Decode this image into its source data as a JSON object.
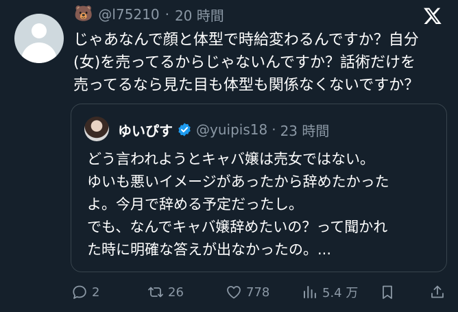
{
  "tweet": {
    "avatar_icon": "default-profile-icon",
    "emoji": "🐻",
    "handle": "@l75210",
    "separator": "·",
    "time": "20 時間",
    "text": "じゃあなんで顔と体型で時給変わるんですか？自分\n(女)を売ってるからじゃないんですか？話術だけを\n売ってるなら見た目も体型も関係なくないですか？"
  },
  "quote": {
    "name": "ゆいぴす",
    "verified_icon": "verified-badge-icon",
    "handle": "@yuipis18",
    "separator": "·",
    "time": "23 時間",
    "text": "どう言われようとキャバ嬢は売女ではない。\nゆいも悪いイメージがあったから辞めたかった\nよ。今月で辞める予定だったし。\nでも、なんでキャバ嬢辞めたいの？って聞かれ\nた時に明確な答えが出なかったの。..."
  },
  "actions": {
    "replies": "2",
    "reposts": "26",
    "likes": "778",
    "views": "5.4 万"
  },
  "colors": {
    "background": "#15202b",
    "text": "#ffffff",
    "secondary": "#8b98a5",
    "border": "#38444d",
    "verified": "#1d9bf0"
  }
}
